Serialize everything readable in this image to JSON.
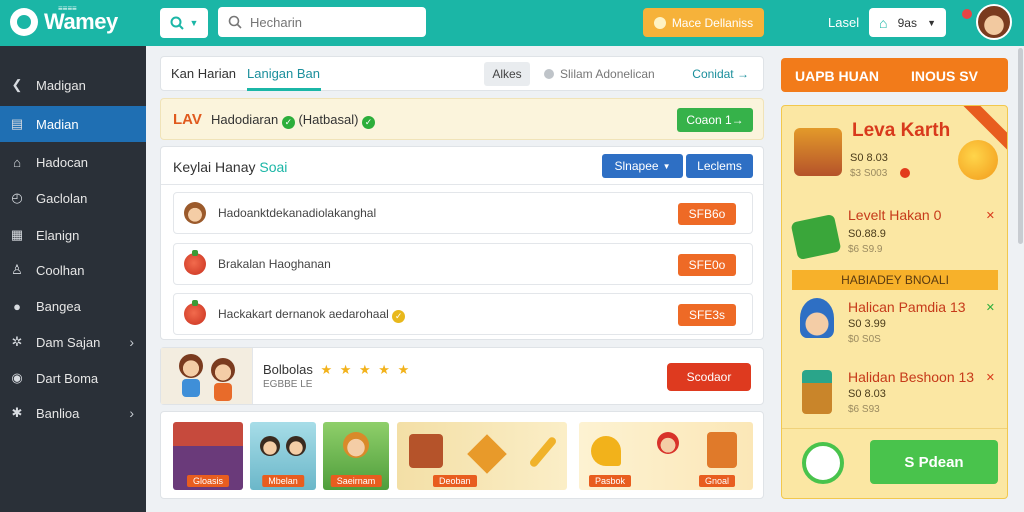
{
  "app": {
    "logo_text": "Wamey",
    "logo_subtext": "≡≡≡≡"
  },
  "topbar": {
    "dropdown_icon": "search-icon",
    "search_placeholder": "Hecharin",
    "promo_label": "Mace Dellaniss",
    "user_label": "Lasel",
    "select_value": "9as",
    "colors": {
      "bar": "#1bb6a6",
      "promo": "#f6b23a"
    }
  },
  "sidebar": {
    "items": [
      {
        "label": "Madigan",
        "icon": "back-arrow-icon",
        "chevron": false
      },
      {
        "label": "Madian",
        "icon": "grid-icon",
        "chevron": false,
        "active": true
      },
      {
        "label": "Hadocan",
        "icon": "home-icon",
        "chevron": false
      },
      {
        "label": "Gaclolan",
        "icon": "clock-icon",
        "chevron": false
      },
      {
        "label": "Elanign",
        "icon": "calendar-icon",
        "chevron": false
      },
      {
        "label": "Coolhan",
        "icon": "person-icon",
        "chevron": false
      },
      {
        "label": "Bangea",
        "icon": "people-icon",
        "chevron": false
      },
      {
        "label": "Dam Sajan",
        "icon": "gear-icon",
        "chevron": true
      },
      {
        "label": "Dart Boma",
        "icon": "pin-icon",
        "chevron": false
      },
      {
        "label": "Banlioa",
        "icon": "settings-icon",
        "chevron": true
      }
    ]
  },
  "tabs": {
    "items": [
      "Kan Harian",
      "Lanigan Ban",
      "Alkes"
    ],
    "active_index": 1,
    "status_text": "Slilam Adonelican",
    "link_text": "Conidat"
  },
  "banner": {
    "brand": "LAV",
    "text_a": "Hadodiaran",
    "text_b": "(Hatbasal)",
    "button": "Coaon 1→"
  },
  "list_panel": {
    "title": "Keylai Hanay",
    "title_accent": "Soai",
    "button_primary": "Slnapee",
    "button_secondary": "Leclems",
    "rows": [
      {
        "text": "Hadoanktdekanadiolakanghal",
        "button": "SFB6o",
        "icon": "kid"
      },
      {
        "text": "Brakalan   Haoghanan",
        "button": "SFE0o",
        "icon": "tomato"
      },
      {
        "text": "Hackakart dernanok aedarohaal",
        "button": "SFE3s",
        "icon": "tomato",
        "check": true
      }
    ]
  },
  "rating": {
    "title": "Bolbolas",
    "stars": "★ ★ ★ ★ ★",
    "subtitle": "EGBBE LE",
    "button": "Scodaor"
  },
  "gallery": {
    "captions": [
      "Gloasis",
      "Mbelan",
      "Saeirnam",
      "Deoban",
      "Pasbok",
      "Gnoal"
    ]
  },
  "right": {
    "header_left": "UAPB HUAN",
    "header_right": "INOUS SV",
    "feature_title": "Leva Karth",
    "feature_amount": "S0 8.03",
    "feature_sub": "$3 S003",
    "items": [
      {
        "title": "Levelt Hakan 0",
        "amount": "S0.88.9",
        "sub": "$6 S9.9"
      },
      {
        "title": "Halican Pamdia 13",
        "amount": "S0 3.99",
        "sub": "$0 S0S"
      },
      {
        "title": "Halidan Beshoon 13",
        "amount": "S0 8.03",
        "sub": "$6 S93"
      }
    ],
    "mid_banner": "HABIADEY BNOALI",
    "footer_button": "S Pdean",
    "colors": {
      "header": "#f27b1a",
      "panel": "#fbe7a3",
      "cta": "#49c34c"
    }
  }
}
